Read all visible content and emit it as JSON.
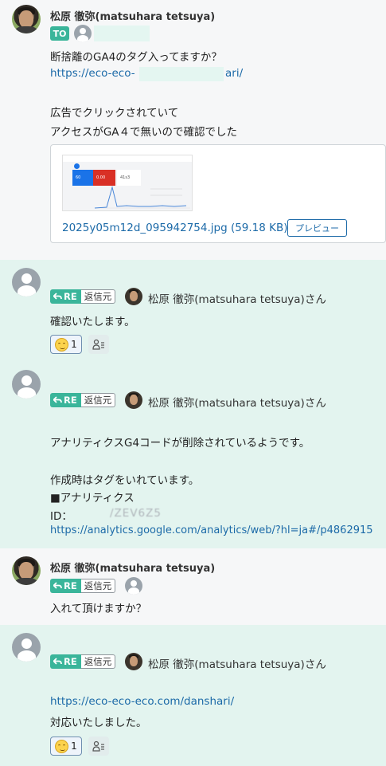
{
  "messages": [
    {
      "sender": "松原 徹弥(matsuhara tetsuya)",
      "to_label": "TO",
      "lines": [
        "断捨離のGA4のタグ入ってますか？",
        "https://eco-eco-",
        "ari/",
        "広告でクリックされていて",
        "アクセスがGA４で無いので確認でした"
      ],
      "attachment": {
        "filename": "2025y05m12d_095942754.jpg (59.18 KB)",
        "preview_label": "プレビュー",
        "thumb_numbers": [
          "60",
          "0.00",
          "0",
          "41s3"
        ]
      }
    },
    {
      "re_label": "RE",
      "source_label": "返信元",
      "reply_to": "松原 徹弥(matsuhara tetsuya)さん",
      "lines": [
        "確認いたします。"
      ],
      "reaction_count": "1"
    },
    {
      "re_label": "RE",
      "source_label": "返信元",
      "reply_to": "松原 徹弥(matsuhara tetsuya)さん",
      "lines": [
        "アナリティクスG4コードが削除されているようです。",
        "作成時はタグをいれています。",
        "■アナリティクス",
        "ID：",
        "/ZEV6Z5",
        "https://analytics.google.com/analytics/web/?hl=ja#/p4862915"
      ]
    },
    {
      "sender": "松原 徹弥(matsuhara tetsuya)",
      "re_label": "RE",
      "source_label": "返信元",
      "lines": [
        "入れて頂けますか？"
      ]
    },
    {
      "re_label": "RE",
      "source_label": "返信元",
      "reply_to": "松原 徹弥(matsuhara tetsuya)さん",
      "lines": [
        "https://eco-eco-eco.com/danshari/",
        "対応いたしました。"
      ],
      "reaction_count": "1"
    }
  ],
  "colors": {
    "accent": "#3ab59a",
    "link": "#1c6aa8",
    "reply_bg": "#e3f4ef"
  }
}
